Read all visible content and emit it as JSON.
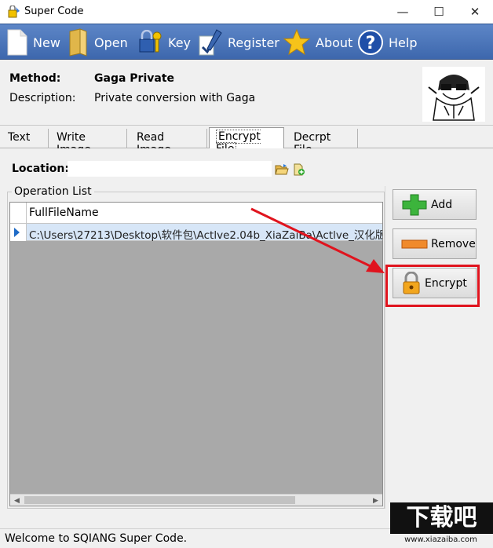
{
  "window": {
    "title": "Super Code",
    "minimize": "—",
    "maximize": "☐",
    "close": "✕"
  },
  "toolbar": {
    "new": "New",
    "open": "Open",
    "key": "Key",
    "register": "Register",
    "about": "About",
    "help": "Help"
  },
  "method": {
    "method_label": "Method:",
    "method_value": "Gaga Private",
    "description_label": "Description:",
    "description_value": "Private conversion with Gaga"
  },
  "tabs": [
    "Text",
    "Write Image",
    "Read Image",
    "Encrypt File",
    "Decrpt File"
  ],
  "active_tab": "Encrypt File",
  "location": {
    "label": "Location:",
    "value": ""
  },
  "operation_list": {
    "title": "Operation List",
    "column": "FullFileName",
    "rows": [
      "C:\\Users\\27213\\Desktop\\软件包\\Actlve2.04b_XiaZaiBa\\Actlve_汉化版"
    ]
  },
  "buttons": {
    "add": "Add",
    "remove": "Remove",
    "encrypt": "Encrypt"
  },
  "status": {
    "text": "Welcome to SQIANG Super Code."
  },
  "watermark": {
    "text": "下载吧",
    "url": "www.xiazaiba.com"
  },
  "colors": {
    "toolbar": "#4a74b8",
    "highlight": "#e0141e",
    "selection": "#d7e6f7",
    "grid_bg": "#a9a9a9"
  }
}
